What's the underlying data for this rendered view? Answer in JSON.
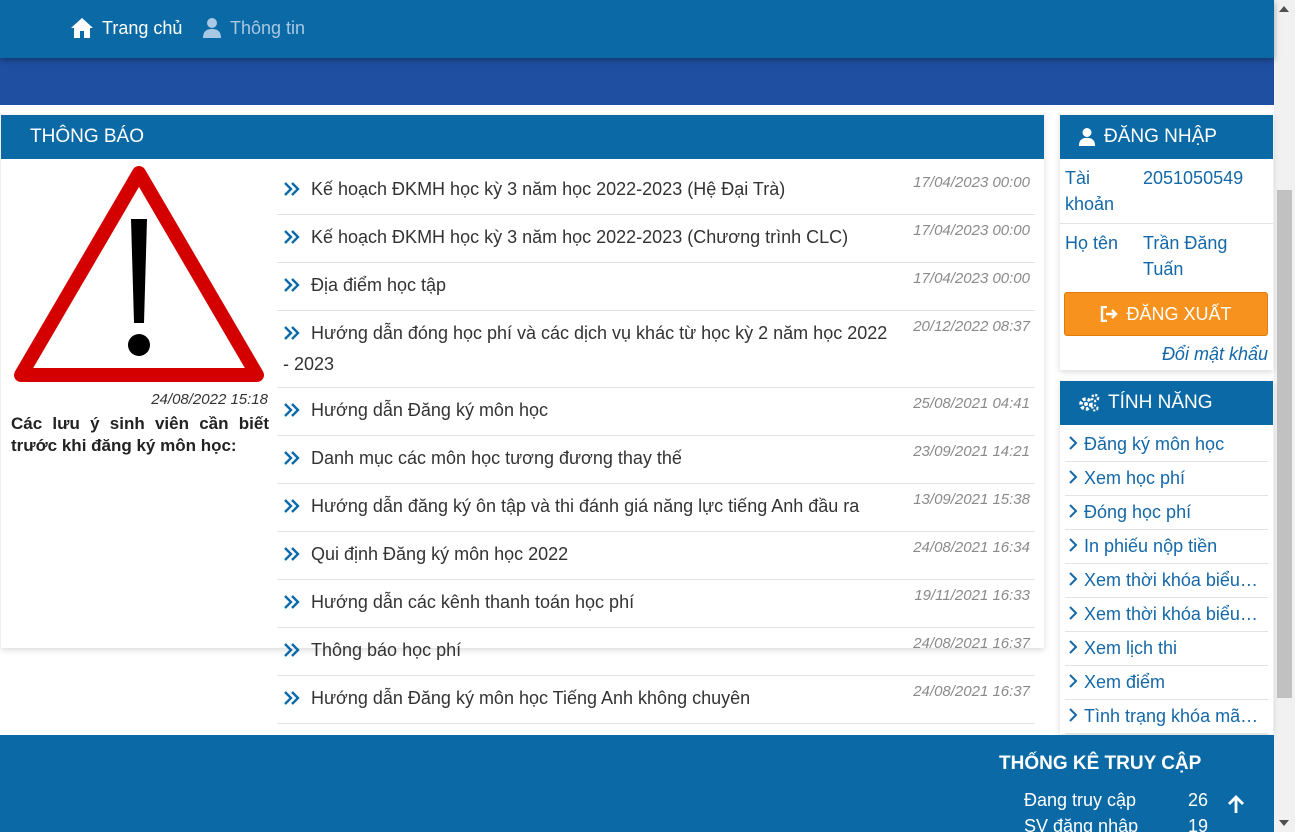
{
  "nav": {
    "home_label": "Trang chủ",
    "info_label": "Thông tin"
  },
  "notice": {
    "title": "THÔNG BÁO",
    "featured": {
      "date": "24/08/2022 15:18",
      "title": "Các lưu ý sinh viên cần biết trước khi đăng ký môn học:",
      "image_icon": "warning-triangle-icon"
    },
    "items": [
      {
        "title": "Kế hoạch ĐKMH học kỳ 3 năm học 2022-2023 (Hệ Đại Trà)",
        "date": "17/04/2023 00:00"
      },
      {
        "title": "Kế hoạch ĐKMH học kỳ 3 năm học 2022-2023 (Chương trình CLC)",
        "date": "17/04/2023 00:00"
      },
      {
        "title": "Địa điểm học tập",
        "date": "17/04/2023 00:00"
      },
      {
        "title": "Hướng dẫn đóng học phí và các dịch vụ khác từ học kỳ 2 năm học 2022 - 2023",
        "date": "20/12/2022 08:37"
      },
      {
        "title": "Hướng dẫn Đăng ký môn học",
        "date": "25/08/2021 04:41"
      },
      {
        "title": "Danh mục các môn học tương đương thay thế",
        "date": "23/09/2021 14:21"
      },
      {
        "title": "Hướng dẫn đăng ký ôn tập và thi đánh giá năng lực tiếng Anh đầu ra",
        "date": "13/09/2021 15:38"
      },
      {
        "title": "Qui định Đăng ký môn học 2022",
        "date": "24/08/2021 16:34"
      },
      {
        "title": "Hướng dẫn các kênh thanh toán học phí",
        "date": "19/11/2021 16:33"
      },
      {
        "title": "Thông báo học phí",
        "date": "24/08/2021 16:37"
      },
      {
        "title": "Hướng dẫn Đăng ký môn học Tiếng Anh không chuyên",
        "date": "24/08/2021 16:37"
      }
    ]
  },
  "login": {
    "title": "ĐĂNG NHẬP",
    "account_label": "Tài khoản",
    "account_value": "2051050549",
    "name_label": "Họ tên",
    "name_value": "Trần Đăng Tuấn",
    "logout_label": "ĐĂNG XUẤT",
    "change_password": "Đổi mật khẩu"
  },
  "features": {
    "title": "TÍNH NĂNG",
    "items": [
      "Đăng ký môn học",
      "Xem học phí",
      "Đóng học phí",
      "In phiếu nộp tiền",
      "Xem thời khóa biểu…",
      "Xem thời khóa biểu…",
      "Xem lịch thi",
      "Xem điểm",
      "Tình trạng khóa mã…"
    ]
  },
  "footer": {
    "stats_title": "THỐNG KÊ TRUY CẬP",
    "online_label": "Đang truy cập",
    "online_value": "26",
    "students_label": "SV đăng nhập",
    "students_value": "19"
  },
  "colors": {
    "primary": "#0b6aa6",
    "banner": "#1f4fa0",
    "logout": "#f7921e",
    "link": "#1468a8"
  }
}
